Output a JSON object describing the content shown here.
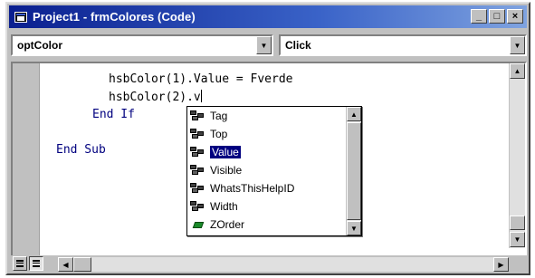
{
  "window": {
    "title": "Project1 - frmColores (Code)",
    "buttons": {
      "minimize": "_",
      "maximize": "□",
      "close": "×"
    }
  },
  "object_combo": {
    "value": "optColor"
  },
  "procedure_combo": {
    "value": "Click"
  },
  "code": {
    "line1": "hsbColor(1).Value = Fverde",
    "line2": "hsbColor(2).v",
    "line3": "End If",
    "line4": "End Sub"
  },
  "autocomplete": {
    "items": [
      {
        "label": "Tag",
        "icon": "property-icon"
      },
      {
        "label": "Top",
        "icon": "property-icon"
      },
      {
        "label": "Value",
        "icon": "property-icon",
        "selected": true
      },
      {
        "label": "Visible",
        "icon": "property-icon"
      },
      {
        "label": "WhatsThisHelpID",
        "icon": "property-icon"
      },
      {
        "label": "Width",
        "icon": "property-icon"
      },
      {
        "label": "ZOrder",
        "icon": "method-icon"
      }
    ]
  },
  "colors": {
    "titlebar_start": "#0a1f8f",
    "keyword": "#00007f",
    "selection": "#000080"
  }
}
